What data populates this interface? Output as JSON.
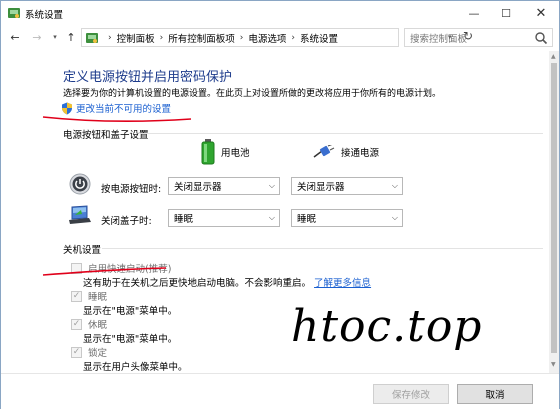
{
  "window": {
    "title": "系统设置",
    "controls": {
      "minimize": "—",
      "maximize": "☐",
      "close": "✕"
    }
  },
  "nav": {
    "back": "←",
    "forward": "→",
    "history": "▾",
    "up": "↑",
    "breadcrumb": [
      "控制面板",
      "所有控制面板项",
      "电源选项",
      "系统设置"
    ],
    "separator": "›",
    "search_placeholder": "搜索控制面板"
  },
  "page": {
    "heading": "定义电源按钮并启用密码保护",
    "description": "选择要为你的计算机设置的电源设置。在此页上对设置所做的更改将应用于你所有的电源计划。",
    "change_settings_link": "更改当前不可用的设置"
  },
  "power_buttons": {
    "section_title": "电源按钮和盖子设置",
    "columns": {
      "battery": "用电池",
      "plugged_in": "接通电源"
    },
    "rows": [
      {
        "label": "按电源按钮时:",
        "battery_value": "关闭显示器",
        "plugged_value": "关闭显示器",
        "icon": "power-icon"
      },
      {
        "label": "关闭盖子时:",
        "battery_value": "睡眠",
        "plugged_value": "睡眠",
        "icon": "laptop-lid-icon"
      }
    ]
  },
  "shutdown": {
    "section_title": "关机设置",
    "items": [
      {
        "label": "启用快速启动(推荐)",
        "checked": false,
        "desc": "这有助于在关机之后更快地启动电脑。不会影响重启。",
        "link": "了解更多信息"
      },
      {
        "label": "睡眠",
        "checked": true,
        "desc": "显示在\"电源\"菜单中。"
      },
      {
        "label": "休眠",
        "checked": true,
        "desc": "显示在\"电源\"菜单中。"
      },
      {
        "label": "锁定",
        "checked": true,
        "desc": "显示在用户头像菜单中。"
      }
    ]
  },
  "buttons": {
    "save": "保存修改",
    "cancel": "取消"
  },
  "watermark": "htoc.top",
  "colors": {
    "heading": "#1e3c8c",
    "link": "#1a5fd0",
    "annotation": "#e0001a"
  }
}
